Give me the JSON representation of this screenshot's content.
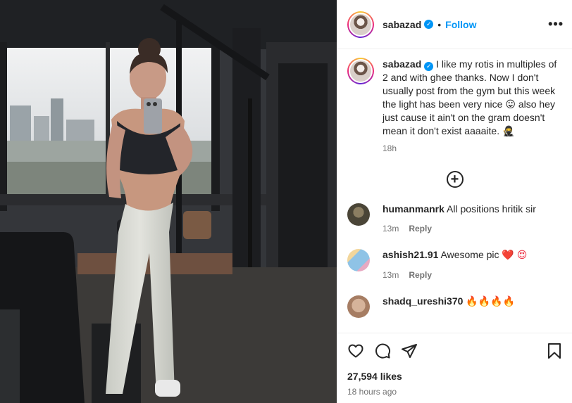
{
  "post": {
    "username": "sabazad",
    "follow_label": "Follow",
    "more_label": "•••",
    "verified": true
  },
  "caption": {
    "username": "sabazad",
    "text": " I like my rotis in multiples of 2 and with ghee thanks. Now I don't usually post from the gym but this week the light has been very nice 😛 also hey just cause it ain't on the gram doesn't mean it don't exist aaaaite. 🥷",
    "time": "18h"
  },
  "load_more_icon": "plus-circle-icon",
  "comments": [
    {
      "username": "humanmanrk",
      "text": "All positions hritik sir",
      "time": "13m",
      "reply_label": "Reply",
      "avatar_color": "#5c5747"
    },
    {
      "username": "ashish21.91",
      "text": "Awesome pic",
      "emoji": "❤️ 😍",
      "time": "13m",
      "reply_label": "Reply",
      "avatar_color": "#9ec9e8"
    },
    {
      "username": "shadq_ureshi370",
      "text": "🔥🔥🔥🔥",
      "time": "",
      "reply_label": "",
      "avatar_color": "#c9a489"
    }
  ],
  "actions": {
    "like_icon": "heart-icon",
    "comment_icon": "comment-icon",
    "share_icon": "share-icon",
    "save_icon": "bookmark-icon"
  },
  "likes": "27,594 likes",
  "posted_ago": "18 hours ago",
  "colors": {
    "accent": "#0095f6",
    "text": "#262626",
    "muted": "#737373"
  }
}
